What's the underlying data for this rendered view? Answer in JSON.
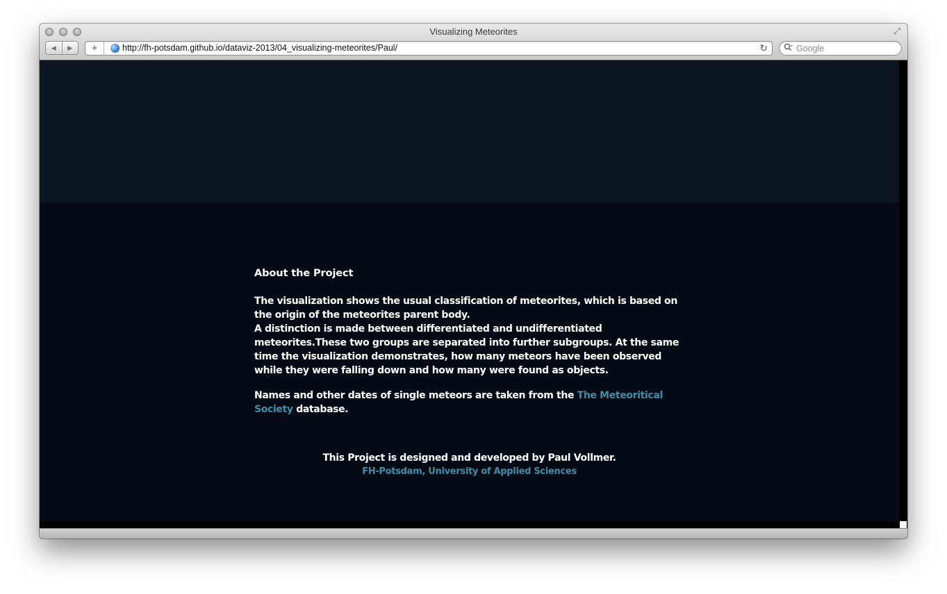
{
  "browser": {
    "window_title": "Visualizing Meteorites",
    "url": "http://fh-potsdam.github.io/dataviz-2013/04_visualizing-meteorites/Paul/",
    "search_placeholder": "Google",
    "add_label": "+",
    "back_glyph": "◀",
    "forward_glyph": "▶",
    "reload_glyph": "↻",
    "search_glyph": "🔍︎",
    "fullscreen_glyph": "⤢"
  },
  "about": {
    "heading": "About the Project",
    "paragraph1": "The visualization shows the usual classification of meteorites, which is based on the origin of the meteorites parent body.",
    "paragraph2": "A distinction is made between differentiated and undifferentiated meteorites.These two groups are separated into further subgroups. At the same time the visualization demonstrates, how many meteors have been observed while they were falling down and how many were found as objects.",
    "paragraph3_before": "Names and other dates of single meteors are taken from the ",
    "paragraph3_link": "The Meteoritical Society",
    "paragraph3_after": " database."
  },
  "footer": {
    "credit": "This Project is designed and developed by Paul Vollmer.",
    "school_link": "FH-Potsdam, University of Applied Sciences"
  },
  "colors": {
    "page_background": "#040b14",
    "hero_background": "#0c1620",
    "link": "#3f8ea8",
    "text": "#ffffff"
  }
}
